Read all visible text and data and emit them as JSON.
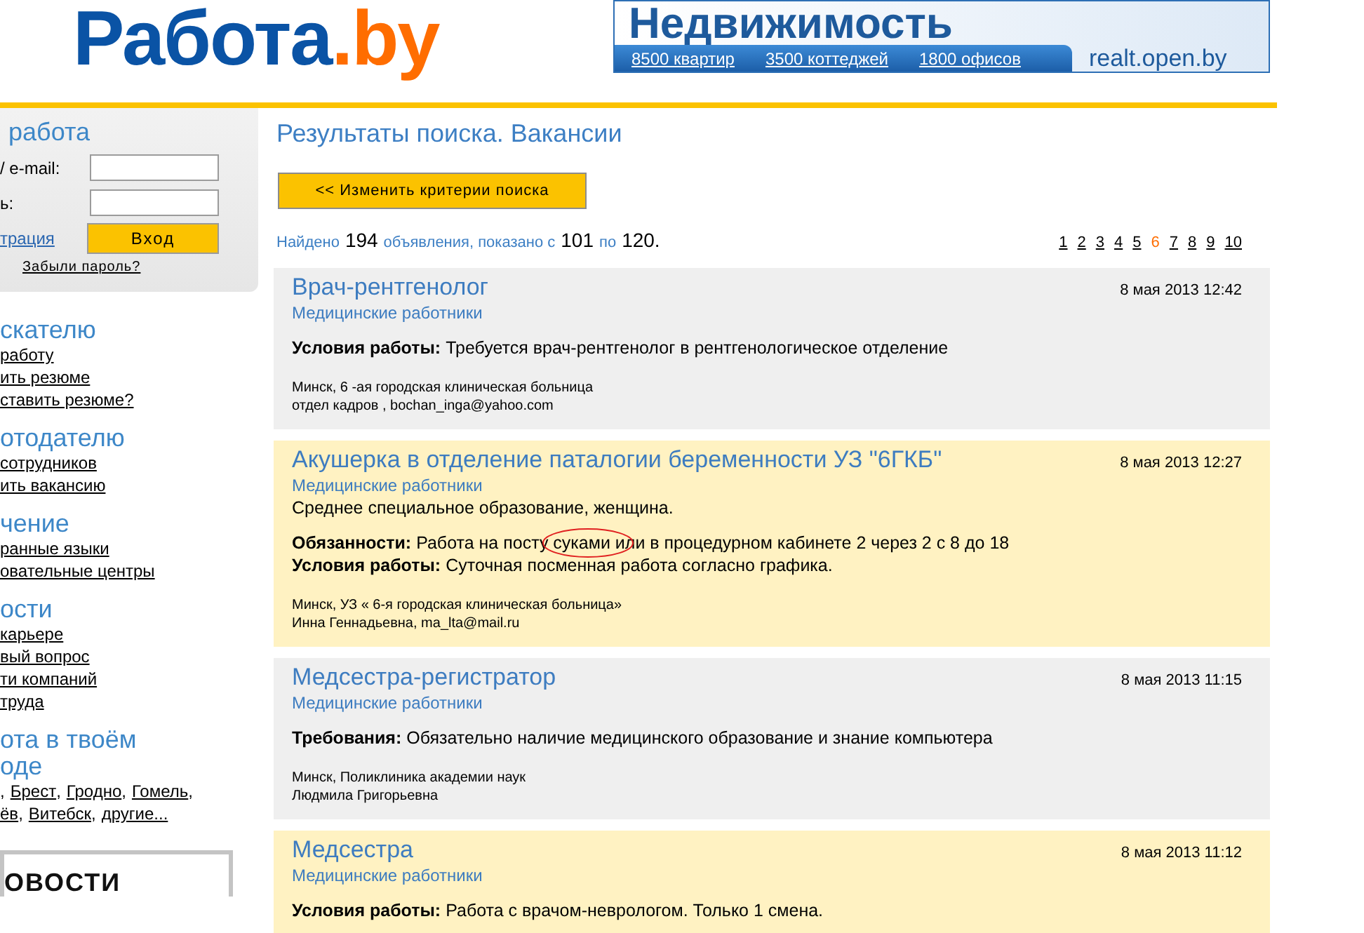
{
  "header": {
    "logo": {
      "text": "Работа",
      "dot": ".",
      "tld": "by"
    },
    "banner": {
      "title": "Недвижимость",
      "links": [
        "8500 квартир",
        "3500 коттеджей",
        "1800 офисов"
      ],
      "domain": "realt.open.by"
    }
  },
  "sidebar": {
    "login": {
      "heading": "работа",
      "fields": [
        {
          "label": "/ e-mail:"
        },
        {
          "label": "ь:"
        }
      ],
      "register_link": "трация",
      "submit": "Вход",
      "forgot": "Забыли пароль?"
    },
    "sections": [
      {
        "heading": "скателю",
        "links": [
          "работу",
          "ить резюме",
          "ставить резюме?"
        ]
      },
      {
        "heading": "отодателю",
        "links": [
          "сотрудников",
          "ить вакансию"
        ]
      },
      {
        "heading": "чение",
        "links": [
          "ранные языки",
          "овательные центры"
        ]
      },
      {
        "heading": "ости",
        "links": [
          "карьере",
          "вый вопрос",
          "ти компаний",
          "труда"
        ]
      }
    ],
    "cities": {
      "heading": "ота в твоём оде",
      "rows": [
        [
          {
            "sep": ","
          },
          {
            "name": "Брест",
            "sep": ","
          },
          {
            "name": "Гродно",
            "sep": ","
          },
          {
            "name": "Гомель",
            "sep": ","
          }
        ],
        [
          {
            "name": "ёв",
            "sep": ","
          },
          {
            "name": "Витебск",
            "sep": ","
          },
          {
            "name": "другие..."
          }
        ]
      ]
    },
    "news_banner": "ОВОСТИ"
  },
  "main": {
    "title": "Результаты поиска. Вакансии",
    "change_button": "<< Изменить критерии поиска",
    "summary": [
      {
        "text": "Найдено",
        "kind": "label"
      },
      {
        "text": "194",
        "kind": "number"
      },
      {
        "text": "объявления, показано с",
        "kind": "label"
      },
      {
        "text": "101",
        "kind": "number"
      },
      {
        "text": "по",
        "kind": "label"
      },
      {
        "text": "120.",
        "kind": "number"
      }
    ],
    "pages": [
      {
        "label": "1",
        "selected": false
      },
      {
        "label": "2",
        "selected": false
      },
      {
        "label": "3",
        "selected": false
      },
      {
        "label": "4",
        "selected": false
      },
      {
        "label": "5",
        "selected": false
      },
      {
        "label": "6",
        "selected": true
      },
      {
        "label": "7",
        "selected": false
      },
      {
        "label": "8",
        "selected": false
      },
      {
        "label": "9",
        "selected": false
      },
      {
        "label": "10",
        "selected": false
      }
    ],
    "listings": [
      {
        "title": "Врач-рентгенолог",
        "category": "Медицинские работники",
        "date": "8 мая 2013 12:42",
        "highlighted": false,
        "lines": [
          {
            "label": "Условия работы:",
            "text": "Требуется врач-рентгенолог в рентгенологическое отделение",
            "marked": false
          }
        ],
        "contact": [
          "Минск, 6 -ая городская клиническая больница",
          "отдел кадров , bochan_inga@yahoo.com"
        ]
      },
      {
        "title": "Акушерка в отделение паталогии беременности УЗ \"6ГКБ\"",
        "category": "Медицинские работники",
        "date": "8 мая 2013 12:27",
        "highlighted": true,
        "intro": "Среднее специальное образование, женщина.",
        "lines": [
          {
            "label": "Обязанности:",
            "text": "Работа на посту суками или в процедурном кабинете 2 через 2 с 8 до 18",
            "marked": true
          },
          {
            "label": "Условия работы:",
            "text": "Суточная посменная работа согласно графика.",
            "marked": false
          }
        ],
        "contact": [
          "Минск, УЗ « 6-я городская клиническая больница»",
          "Инна Геннадьевна, ma_lta@mail.ru"
        ]
      },
      {
        "title": "Медсестра-регистратор",
        "category": "Медицинские работники",
        "date": "8 мая 2013 11:15",
        "highlighted": false,
        "lines": [
          {
            "label": "Требования:",
            "text": "Обязательно наличие медицинского образование и знание компьютера",
            "marked": false
          }
        ],
        "contact": [
          "Минск, Поликлиника академии наук",
          "Людмила Григорьевна"
        ]
      },
      {
        "title": "Медсестра",
        "category": "Медицинские работники",
        "date": "8 мая 2013 11:12",
        "highlighted": true,
        "lines": [
          {
            "label": "Условия работы:",
            "text": "Работа с врачом-неврологом. Только 1 смена.",
            "marked": false
          }
        ]
      }
    ]
  }
}
